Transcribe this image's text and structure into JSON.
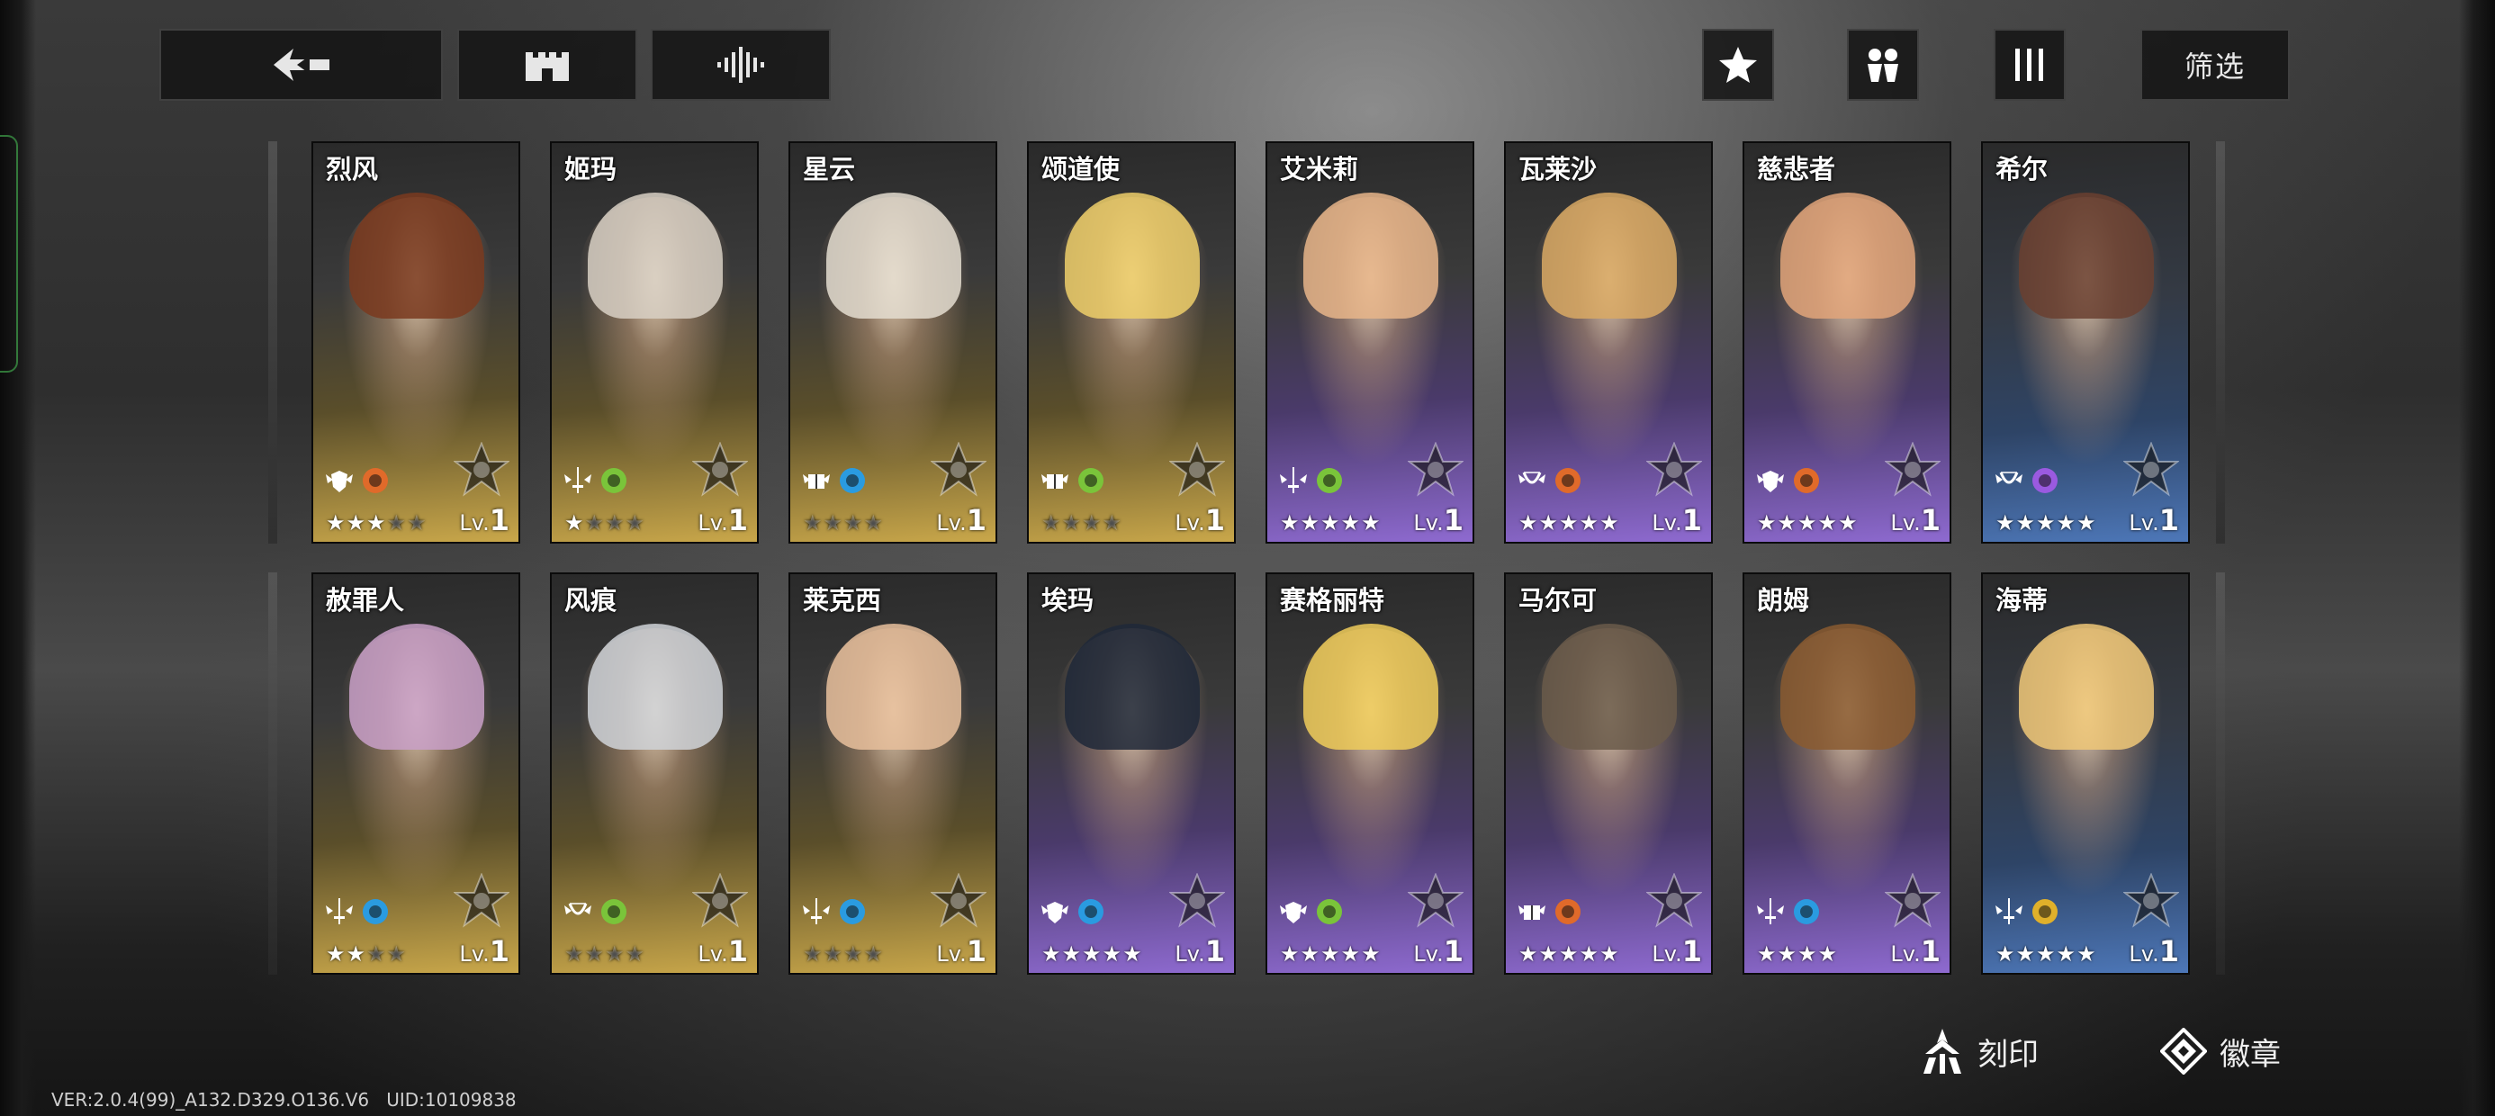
{
  "toolbar": {
    "back_icon": "back-arrow-icon",
    "castle_icon": "castle-icon",
    "sort_icon": "sort-icon",
    "star_icon": "star-icon",
    "group_icon": "group-icon",
    "columns_icon": "columns-icon",
    "filter_label": "筛选"
  },
  "row1": [
    {
      "name": "烈风",
      "theme": "gold",
      "hair": "#7a3a1e",
      "stars": 3,
      "max": 5,
      "lv_label": "Lv.",
      "lv": "1",
      "class_icon": "shield-wing-icon",
      "element_icon": "fire-icon",
      "element_color": "#e06a2a"
    },
    {
      "name": "姬玛",
      "theme": "gold",
      "hair": "#d8d0c4",
      "stars": 1,
      "max": 4,
      "lv_label": "Lv.",
      "lv": "1",
      "class_icon": "sword-wing-icon",
      "element_icon": "nature-icon",
      "element_color": "#7ac43a"
    },
    {
      "name": "星云",
      "theme": "gold",
      "hair": "#e4ddd0",
      "stars": 0,
      "max": 4,
      "lv_label": "Lv.",
      "lv": "1",
      "class_icon": "tome-wing-icon",
      "element_icon": "water-icon",
      "element_color": "#2a9be0"
    },
    {
      "name": "颂道使",
      "theme": "gold",
      "hair": "#efcf6a",
      "stars": 0,
      "max": 4,
      "lv_label": "Lv.",
      "lv": "1",
      "class_icon": "tome-wing-icon",
      "element_icon": "nature-icon",
      "element_color": "#7ac43a"
    },
    {
      "name": "艾米莉",
      "theme": "purple",
      "hair": "#e8b58a",
      "stars": 5,
      "max": 5,
      "lv_label": "Lv.",
      "lv": "1",
      "class_icon": "sword-wing-icon",
      "element_icon": "nature-icon",
      "element_color": "#7ac43a"
    },
    {
      "name": "瓦莱沙",
      "theme": "purple",
      "hair": "#d9a964",
      "stars": 5,
      "max": 5,
      "lv_label": "Lv.",
      "lv": "1",
      "class_icon": "bow-wing-icon",
      "element_icon": "fire-icon",
      "element_color": "#e06a2a"
    },
    {
      "name": "慈悲者",
      "theme": "purple",
      "hair": "#e2a47a",
      "stars": 5,
      "max": 5,
      "lv_label": "Lv.",
      "lv": "1",
      "class_icon": "shield-wing-icon",
      "element_icon": "fire-icon",
      "element_color": "#e06a2a"
    },
    {
      "name": "希尔",
      "theme": "blue",
      "hair": "#6a4030",
      "stars": 5,
      "max": 5,
      "lv_label": "Lv.",
      "lv": "1",
      "class_icon": "bow-wing-icon",
      "element_icon": "arcane-icon",
      "element_color": "#9a5ae0"
    }
  ],
  "row2": [
    {
      "name": "赦罪人",
      "theme": "gold",
      "hair": "#c9a0c8",
      "stars": 2,
      "max": 4,
      "lv_label": "Lv.",
      "lv": "1",
      "class_icon": "sword-wing-icon",
      "element_icon": "water-icon",
      "element_color": "#2a9be0"
    },
    {
      "name": "风痕",
      "theme": "gold",
      "hair": "#d0d4d8",
      "stars": 0,
      "max": 4,
      "lv_label": "Lv.",
      "lv": "1",
      "class_icon": "bow-wing-icon",
      "element_icon": "nature-icon",
      "element_color": "#7ac43a"
    },
    {
      "name": "莱克西",
      "theme": "gold",
      "hair": "#e8c09c",
      "stars": 0,
      "max": 4,
      "lv_label": "Lv.",
      "lv": "1",
      "class_icon": "sword-wing-icon",
      "element_icon": "water-icon",
      "element_color": "#2a9be0"
    },
    {
      "name": "埃玛",
      "theme": "purple",
      "hair": "#1e2838",
      "stars": 5,
      "max": 5,
      "lv_label": "Lv.",
      "lv": "1",
      "class_icon": "shield-wing-icon",
      "element_icon": "water-icon",
      "element_color": "#2a9be0"
    },
    {
      "name": "赛格丽特",
      "theme": "purple",
      "hair": "#f0cc5a",
      "stars": 5,
      "max": 5,
      "lv_label": "Lv.",
      "lv": "1",
      "class_icon": "shield-wing-icon",
      "element_icon": "nature-icon",
      "element_color": "#7ac43a"
    },
    {
      "name": "马尔可",
      "theme": "purple",
      "hair": "#6a5a4a",
      "stars": 5,
      "max": 5,
      "lv_label": "Lv.",
      "lv": "1",
      "class_icon": "tome-wing-icon",
      "element_icon": "fire-icon",
      "element_color": "#e06a2a"
    },
    {
      "name": "朗姆",
      "theme": "purple",
      "hair": "#8a5a30",
      "stars": 4,
      "max": 4,
      "lv_label": "Lv.",
      "lv": "1",
      "class_icon": "sword-wing-icon",
      "element_icon": "water-icon",
      "element_color": "#2a9be0"
    },
    {
      "name": "海蒂",
      "theme": "blue",
      "hair": "#f0c878",
      "stars": 5,
      "max": 5,
      "lv_label": "Lv.",
      "lv": "1",
      "class_icon": "sword-wing-icon",
      "element_icon": "light-icon",
      "element_color": "#e0b02a"
    }
  ],
  "bottom": {
    "engrave_label": "刻印",
    "engrave_icon": "engrave-icon",
    "badge_label": "徽章",
    "badge_icon": "badge-icon"
  },
  "footer": {
    "version": "VER:2.0.4(99)_A132.D329.O136.V6",
    "uid": "UID:10109838"
  }
}
